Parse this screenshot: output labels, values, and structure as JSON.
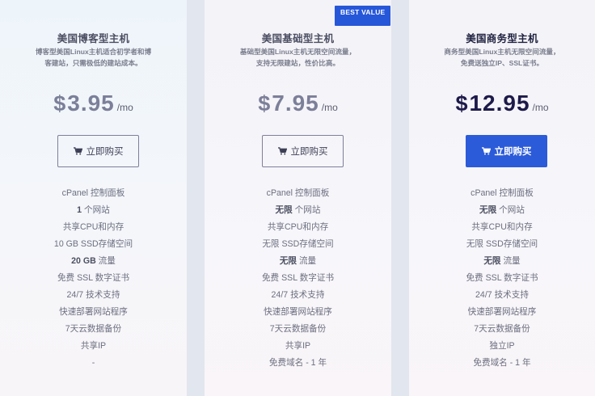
{
  "badge": "BEST VALUE",
  "plans": [
    {
      "title": "美国博客型主机",
      "description": "博客型美国Linux主机适合初学者和博客建站，只需极低的建站成本。",
      "currency": "$",
      "amount": "3.95",
      "period": "/mo",
      "buy_label": "立即购买",
      "features": [
        {
          "b": "",
          "t": "cPanel 控制面板"
        },
        {
          "b": "1",
          "t": " 个网站"
        },
        {
          "b": "",
          "t": "共享CPU和内存"
        },
        {
          "b": "",
          "t": "10 GB SSD存储空间"
        },
        {
          "b": "20 GB",
          "t": " 流量"
        },
        {
          "b": "",
          "t": "免费 SSL 数字证书"
        },
        {
          "b": "",
          "t": "24/7 技术支持"
        },
        {
          "b": "",
          "t": "快速部署网站程序"
        },
        {
          "b": "",
          "t": "7天云数据备份"
        },
        {
          "b": "",
          "t": "共享IP"
        },
        {
          "b": "",
          "t": "-"
        }
      ]
    },
    {
      "title": "美国基础型主机",
      "description": "基础型美国Linux主机无限空间流量，支持无限建站，性价比高。",
      "currency": "$",
      "amount": "7.95",
      "period": "/mo",
      "buy_label": "立即购买",
      "features": [
        {
          "b": "",
          "t": "cPanel 控制面板"
        },
        {
          "b": "无限",
          "t": " 个网站"
        },
        {
          "b": "",
          "t": "共享CPU和内存"
        },
        {
          "b": "",
          "t": "无限 SSD存储空间"
        },
        {
          "b": "无限",
          "t": " 流量"
        },
        {
          "b": "",
          "t": "免费 SSL 数字证书"
        },
        {
          "b": "",
          "t": "24/7 技术支持"
        },
        {
          "b": "",
          "t": "快速部署网站程序"
        },
        {
          "b": "",
          "t": "7天云数据备份"
        },
        {
          "b": "",
          "t": "共享IP"
        },
        {
          "b": "",
          "t": "免费域名 - 1 年"
        }
      ]
    },
    {
      "title": "美国商务型主机",
      "description": "商务型美国Linux主机无限空间流量，免费送独立IP、SSL证书。",
      "currency": "$",
      "amount": "12.95",
      "period": "/mo",
      "buy_label": "立即购买",
      "features": [
        {
          "b": "",
          "t": "cPanel 控制面板"
        },
        {
          "b": "无限",
          "t": " 个网站"
        },
        {
          "b": "",
          "t": "共享CPU和内存"
        },
        {
          "b": "",
          "t": "无限 SSD存储空间"
        },
        {
          "b": "无限",
          "t": " 流量"
        },
        {
          "b": "",
          "t": "免费 SSL 数字证书"
        },
        {
          "b": "",
          "t": "24/7 技术支持"
        },
        {
          "b": "",
          "t": "快速部署网站程序"
        },
        {
          "b": "",
          "t": "7天云数据备份"
        },
        {
          "b": "",
          "t": "独立IP"
        },
        {
          "b": "",
          "t": "免费域名 - 1 年"
        }
      ]
    }
  ],
  "icons": {
    "buy": "shopping-cart-icon"
  },
  "colors": {
    "accent": "#2c5bd9",
    "featured_price": "#1d1a4a",
    "muted_price": "#7c7f99"
  }
}
